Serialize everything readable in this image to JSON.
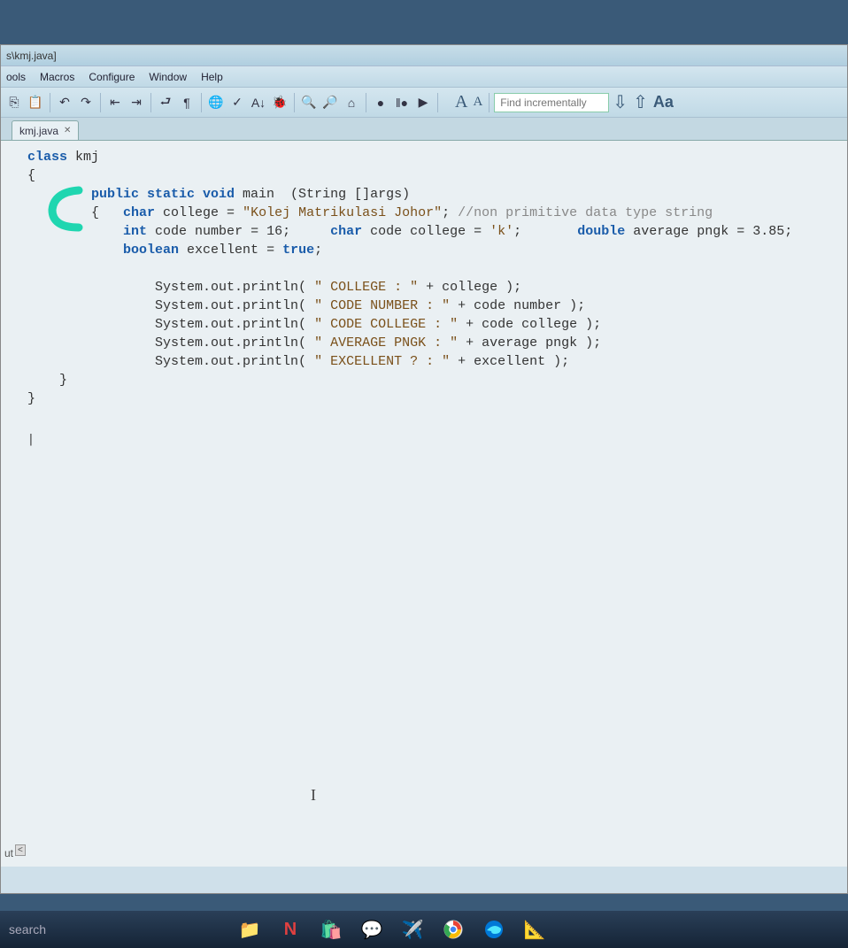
{
  "title_bar": "s\\kmj.java]",
  "menu": {
    "tools": "ools",
    "macros": "Macros",
    "configure": "Configure",
    "window": "Window",
    "help": "Help"
  },
  "toolbar": {
    "find_placeholder": "Find incrementally",
    "font_large": "A",
    "font_small": "A",
    "aa_btn": "Aa",
    "down_arrow": "⇩",
    "up_arrow": "⇧"
  },
  "tab": {
    "label": "kmj.java",
    "close": "✕"
  },
  "code": {
    "line1_class": "class",
    "line1_name": " kmj",
    "line2": "{",
    "line3_p1": "public static void",
    "line3_p2": " main  (String []args)",
    "line4_brace": "{   ",
    "line4_char": "char",
    "line4_var": " college = ",
    "line4_str": "\"Kolej Matrikulasi Johor\"",
    "line4_semi": "; ",
    "line4_com": "//non primitive data type string",
    "line5_int": "int",
    "line5_var": " code number = ",
    "line5_val": "16",
    "line5_semi": ";     ",
    "line5_char": "char",
    "line5_var2": " code college = ",
    "line5_str": "'k'",
    "line5_semi2": ";       ",
    "line5_dbl": "double",
    "line5_var3": " average pngk = ",
    "line5_val3": "3.85",
    "line5_semi3": ";",
    "line6_bool": "boolean",
    "line6_var": " excellent = ",
    "line6_true": "true",
    "line6_semi": ";",
    "line8": "System.out.println( ",
    "line8_s": "\" COLLEGE : \"",
    "line8_r": " + college );",
    "line9": "System.out.println( ",
    "line9_s": "\" CODE NUMBER : \"",
    "line9_r": " + code number );",
    "line10": "System.out.println( ",
    "line10_s": "\" CODE COLLEGE : \"",
    "line10_r": " + code college );",
    "line11": "System.out.println( ",
    "line11_s": "\" AVERAGE PNGK : \"",
    "line11_r": " + average pngk );",
    "line12": "System.out.println( ",
    "line12_s": "\" EXCELLENT ? : \"",
    "line12_r": " + excellent );",
    "line13": "    }",
    "line14": "}",
    "cursor_row": "|"
  },
  "out_label": "ut",
  "scroll_left": "<",
  "bottom_cursor": "I",
  "taskbar": {
    "search": "search"
  }
}
